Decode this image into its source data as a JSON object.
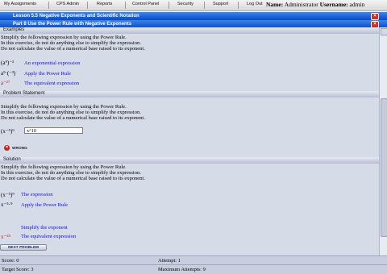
{
  "nav": {
    "items": [
      "My Assignments",
      "CPS Admin",
      "Reports",
      "Control Panel",
      "Security",
      "Support",
      "Log Out"
    ],
    "name_label": "Name:",
    "name_value": "Administrator",
    "username_label": "Username:",
    "username_value": "admin"
  },
  "lesson": {
    "title": "Lesson  5.5 Negative Exponents and Scientific Notation",
    "part": "Part 8 Use the Power Rule with Negative Exponents"
  },
  "examples": {
    "header": "Examples",
    "line1": "Simplify the following expression by using the Power Rule.",
    "line2": "In this exercise, do not do anything else to simplify the expression.",
    "line3": "Do not calculate the value of a numerical base raised to its exponent.",
    "expr1": "(a⁹)⁻³",
    "expr1_label": "An exponential expression",
    "expr2": "a⁹·(⁻³)",
    "expr2_label": "Apply the Power Rule",
    "expr3": "a⁻²⁷",
    "expr3_label": "The equivalent expression"
  },
  "problem": {
    "header": "Problem Statement",
    "line1": "Simplify the following expression by using the Power Rule.",
    "line2": "In this exercise, do not do anything else to simplify the expression.",
    "line3": "Do not calculate the value of a numerical base raised to its exponent.",
    "expr": "(x⁻⁵)⁹",
    "answer": "x^10",
    "result": "WRONG"
  },
  "solution": {
    "header": "Solution",
    "line1": "Simplify the following expression by using the Power Rule.",
    "line2": "In this exercise, do not do anything else to simplify the expression.",
    "line3": "Do not calculate the value of a numerical base raised to its exponent.",
    "expr1": "(x⁻⁵)⁹",
    "expr1_label": "The expression",
    "expr2": "x⁻⁵·⁹",
    "expr2_label": "Apply the Power Rule",
    "step3_label": "Simplify the exponent",
    "expr4": "x⁻⁴⁵",
    "expr4_label": "The equivalent expression"
  },
  "buttons": {
    "next": "NEXT PROBLEM"
  },
  "footer": {
    "score": "Score: 0",
    "attempt": "Attempt: 1",
    "target": "Target Score: 3",
    "max_attempts": "Maximum Attempts: 9"
  },
  "colors": {
    "bar": "#0a49c8",
    "blue_text": "#1010d8",
    "red_text": "#e01010",
    "content_bg": "#d6dbe8"
  },
  "icons": {
    "close": "close-icon",
    "wrong": "wrong-icon"
  }
}
